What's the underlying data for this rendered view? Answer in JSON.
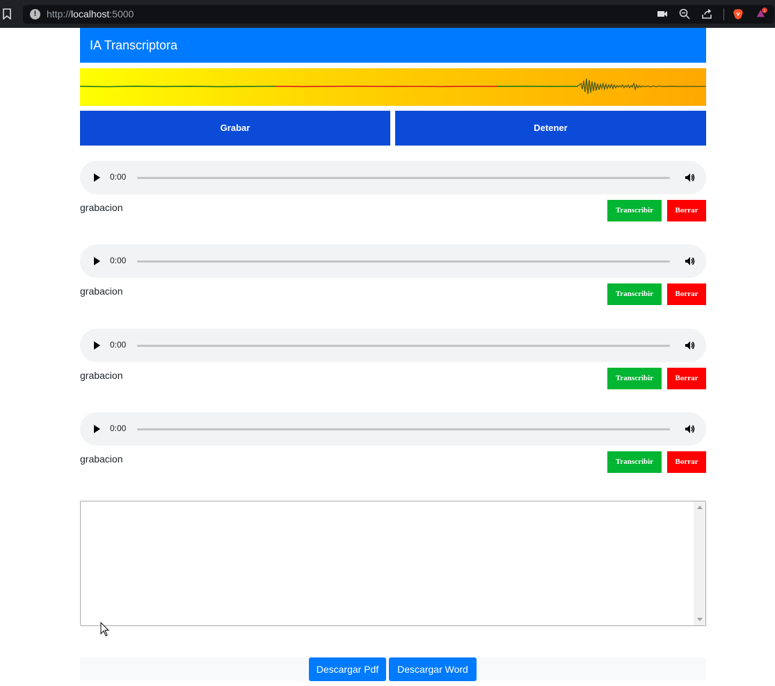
{
  "browser": {
    "url_prefix": "http://",
    "url_host": "localhost",
    "url_port": ":5000"
  },
  "header": {
    "title": "IA Transcriptora"
  },
  "controls": {
    "record_label": "Grabar",
    "stop_label": "Detener"
  },
  "recordings": [
    {
      "time": "0:00",
      "label": "grabacion",
      "transcribe_label": "Transcribir",
      "delete_label": "Borrar"
    },
    {
      "time": "0:00",
      "label": "grabacion",
      "transcribe_label": "Transcribir",
      "delete_label": "Borrar"
    },
    {
      "time": "0:00",
      "label": "grabacion",
      "transcribe_label": "Transcribir",
      "delete_label": "Borrar"
    },
    {
      "time": "0:00",
      "label": "grabacion",
      "transcribe_label": "Transcribir",
      "delete_label": "Borrar"
    }
  ],
  "transcript": {
    "value": ""
  },
  "downloads": {
    "pdf_label": "Descargar Pdf",
    "word_label": "Descargar Word"
  },
  "colors": {
    "header": "#007bff",
    "control": "#0b4bd8",
    "transcribe": "#02b532",
    "delete": "#ff0000",
    "download": "#007bff"
  },
  "icons": [
    "bookmark-icon",
    "info-icon",
    "camera-icon",
    "zoom-icon",
    "share-icon",
    "brave-icon",
    "rewards-icon",
    "play-icon",
    "volume-icon",
    "mouse-cursor-icon"
  ]
}
